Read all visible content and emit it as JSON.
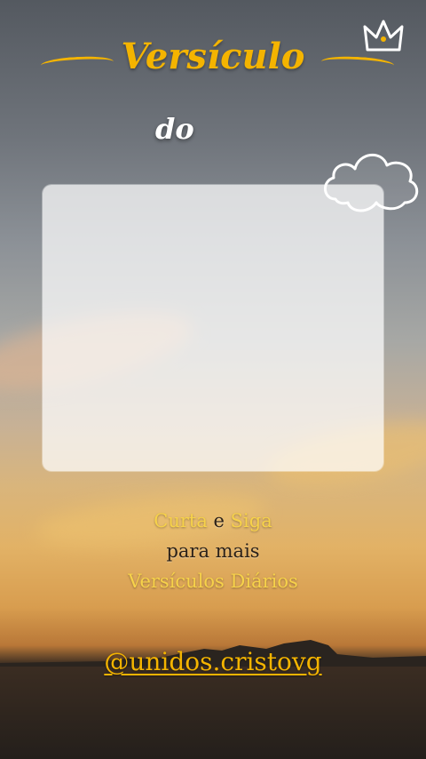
{
  "header": {
    "title": "Versículo",
    "subtitle": "do"
  },
  "icons": {
    "crown": "crown-icon",
    "cloud": "cloud-icon"
  },
  "cta": {
    "word1": "Curta",
    "conj": "e",
    "word2": "Siga",
    "line2": "para mais",
    "line3": "Versículos Diários"
  },
  "footer": {
    "handle": "@unidos.cristovg"
  },
  "colors": {
    "accent": "#f4b400",
    "text_dark": "#2b2118",
    "card": "#ffffffb8"
  }
}
